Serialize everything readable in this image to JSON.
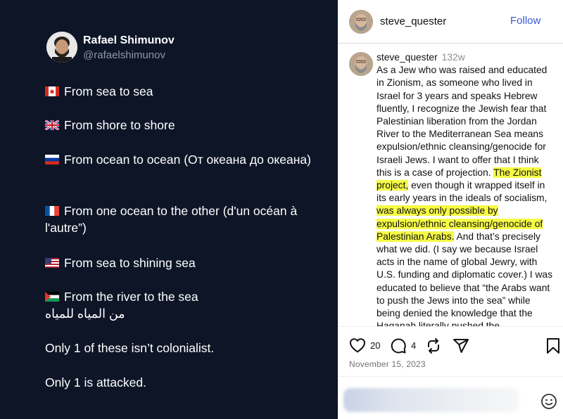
{
  "tweet": {
    "author_name": "Rafael Shimunov",
    "author_handle": "@rafaelshimunov",
    "lines": [
      {
        "flag": "canada-flag",
        "text": "From sea to sea"
      },
      {
        "flag": "uk-flag",
        "text": "From shore to shore"
      },
      {
        "flag": "russia-flag",
        "text": "From ocean to ocean (От океана до океана)"
      },
      {
        "flag": "france-flag",
        "text": "From one ocean to the other (d'un océan à l'autre”)"
      },
      {
        "flag": "usa-flag",
        "text": "From sea to shining sea"
      },
      {
        "flag": "palestine-flag",
        "text": "From the river to the sea"
      }
    ],
    "arabic_line": "من المياه للمياه",
    "closing_1": "Only 1 of these isn’t colonialist.",
    "closing_2": "Only 1 is attacked."
  },
  "instagram": {
    "header_username": "steve_quester",
    "follow_label": "Follow",
    "caption_username": "steve_quester",
    "caption_age": "132w",
    "caption_part1": "As a Jew who was raised and educated in Zionism, as someone who lived in Israel for 3 years and speaks Hebrew fluently, I recognize the Jewish fear that Palestinian liberation from the Jordan River to the Mediterranean Sea means expulsion/ethnic cleansing/genocide for Israeli Jews.  I want to offer that I think this is a case of projection. ",
    "caption_hl1": "The Zionist project,",
    "caption_part2": " even though it wrapped itself in its early years in the ideals of socialism, ",
    "caption_hl2": "was always only possible by expulsion/ethnic cleansing/genocide of Palestinian Arabs.",
    "caption_part3": "  And that’s precisely what we did. (I say we because Israel acts in the name of global Jewry, with U.S. funding and diplomatic cover.) I was educated to believe that “the Arabs want to push the Jews into the sea” while being denied the knowledge that the Haganah literally pushed the",
    "likes": "20",
    "comments": "4",
    "date": "November 15, 2023",
    "icons": [
      "heart-icon",
      "comment-icon",
      "repost-icon",
      "share-icon",
      "bookmark-icon",
      "emoji-icon"
    ],
    "colors": {
      "follow": "#3b57d8",
      "highlight": "#f6fb45",
      "tweet_bg": "#0d1526"
    }
  }
}
